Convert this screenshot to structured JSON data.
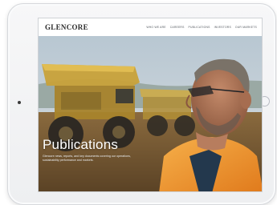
{
  "site": {
    "logo": "GLENCORE",
    "nav": [
      "Who we are",
      "Careers",
      "Publications",
      "Investors",
      "Our markets"
    ]
  },
  "hero": {
    "title": "Publications",
    "description": "Glencore news, reports, and key documents covering our operations, sustainability performance and markets."
  },
  "colors": {
    "accent_vest": "#f29a2e",
    "sky": "#c9d6de",
    "ground": "#7a5d34"
  }
}
